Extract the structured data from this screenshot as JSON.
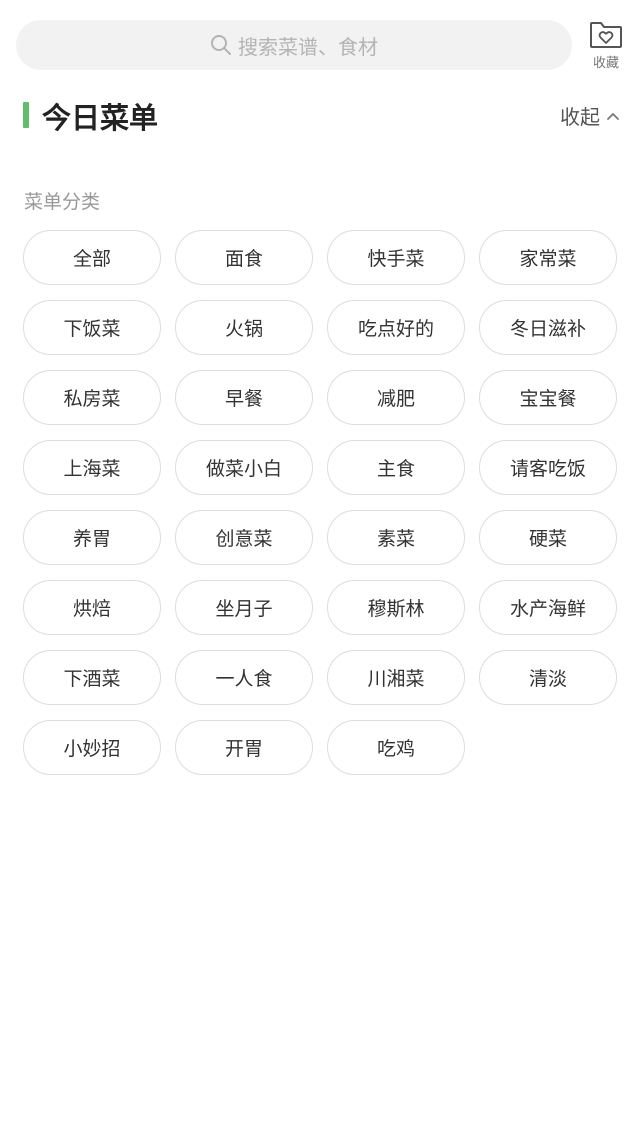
{
  "search": {
    "placeholder": "搜索菜谱、食材",
    "icon": "search-icon"
  },
  "favorites": {
    "label": "收藏",
    "icon": "folder-heart-icon"
  },
  "section": {
    "title": "今日菜单",
    "accent_color": "#5fbe6a",
    "collapse_label": "收起",
    "collapse_icon": "chevron-up-icon"
  },
  "categories": {
    "label": "菜单分类",
    "items": [
      "全部",
      "面食",
      "快手菜",
      "家常菜",
      "下饭菜",
      "火锅",
      "吃点好的",
      "冬日滋补",
      "私房菜",
      "早餐",
      "减肥",
      "宝宝餐",
      "上海菜",
      "做菜小白",
      "主食",
      "请客吃饭",
      "养胃",
      "创意菜",
      "素菜",
      "硬菜",
      "烘焙",
      "坐月子",
      "穆斯林",
      "水产海鲜",
      "下酒菜",
      "一人食",
      "川湘菜",
      "清淡",
      "小妙招",
      "开胃",
      "吃鸡"
    ]
  }
}
